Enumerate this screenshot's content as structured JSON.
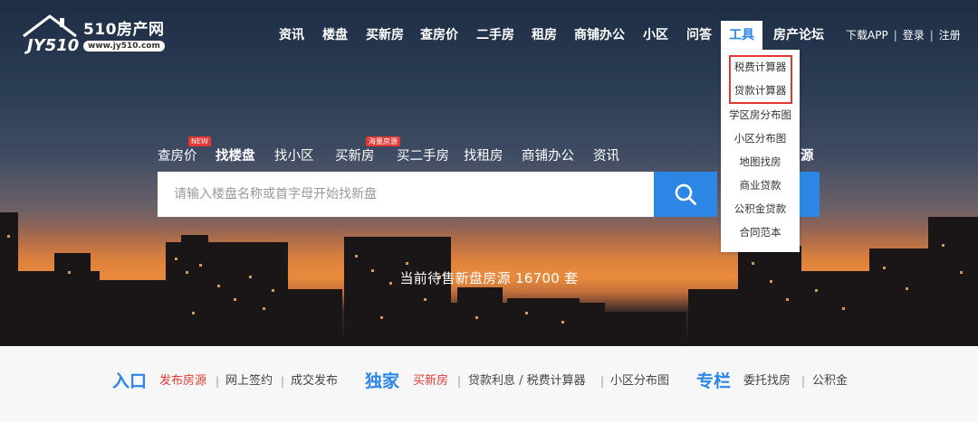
{
  "logo": {
    "name": "510房产网",
    "url": "www.jy510.com"
  },
  "nav": {
    "items": [
      "资讯",
      "楼盘",
      "买新房",
      "查房价",
      "二手房",
      "租房",
      "商铺办公",
      "小区",
      "问答",
      "工具",
      "房产论坛"
    ],
    "active": "工具"
  },
  "topright": {
    "app": "下载APP",
    "sep": "|",
    "login": "登录",
    "register": "注册"
  },
  "tools_dropdown": {
    "items": [
      "税费计算器",
      "贷款计算器",
      "学区房分布图",
      "小区分布图",
      "地图找房",
      "商业贷款",
      "公积金贷款",
      "合同范本"
    ],
    "highlighted": [
      "税费计算器",
      "贷款计算器"
    ],
    "highlight_color": "#e53935"
  },
  "search_tabs": {
    "items": [
      "查房价",
      "找楼盘",
      "找小区",
      "买新房",
      "买二手房",
      "找租房",
      "商铺办公",
      "资讯"
    ],
    "active": "找楼盘",
    "trailing": "源",
    "badge_new": "NEW",
    "badge_hot": "海量房源"
  },
  "search": {
    "placeholder": "请输入楼盘名称或首字母开始找新盘",
    "button_icon": "search-icon"
  },
  "count_text": "当前待售新盘房源 16700 套",
  "bottom": {
    "entry": {
      "title": "入口",
      "links": [
        "发布房源",
        "网上签约",
        "成交发布"
      ]
    },
    "exclusive": {
      "title": "独家",
      "links": [
        "买新房",
        "贷款利息 / 税费计算器",
        "小区分布图"
      ]
    },
    "column": {
      "title": "专栏",
      "links": [
        "委托找房",
        "公积金"
      ]
    },
    "separator": "|"
  },
  "colors": {
    "accent": "#2b86e6",
    "red": "#e53935"
  }
}
